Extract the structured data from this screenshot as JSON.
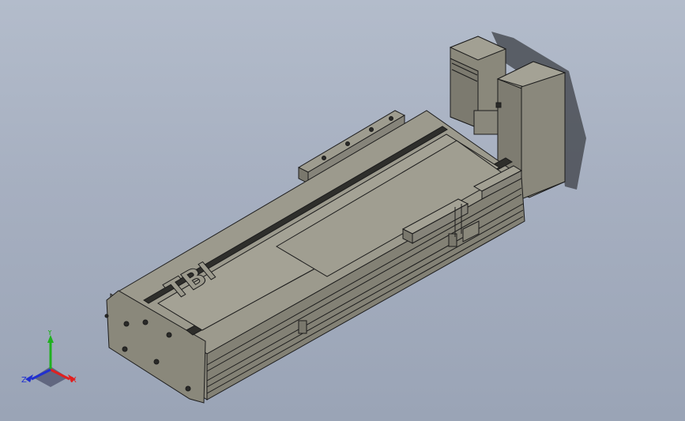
{
  "viewport": {
    "background_top": "#b3bccb",
    "background_bottom": "#9aa4b6"
  },
  "model": {
    "body_color": "#8e8c80",
    "edge_color": "#1c1c1c",
    "top_color": "#9c9a8d",
    "dark_color": "#3a3a36"
  },
  "triad": {
    "x_label": "X",
    "y_label": "Y",
    "z_label": "Z",
    "x_color": "#e02020",
    "y_color": "#20b020",
    "z_color": "#2030d0"
  }
}
